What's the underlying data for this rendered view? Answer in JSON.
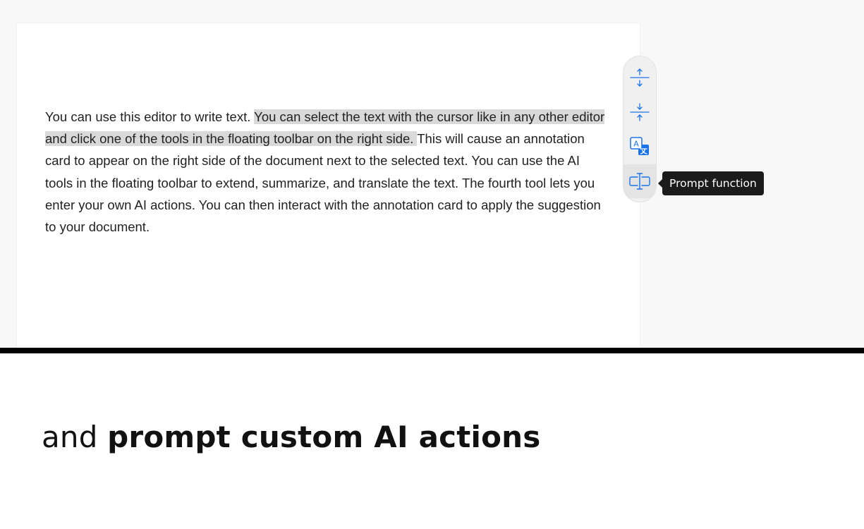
{
  "document": {
    "text_before": "You can use this editor to write text. ",
    "text_selected": "You can select the text with the cursor like in any other editor and click one of the tools in the floating toolbar on the right side. ",
    "text_after": "This will cause an annotation card to appear on the right side of the document next to the selected text. You can use the AI tools in the floating toolbar to extend, summarize, and translate the text. The fourth tool lets you enter your own AI actions. You can then interact with the annotation card to apply the suggestion to your document."
  },
  "toolbar": {
    "tools": [
      {
        "icon": "expand-icon",
        "active": false
      },
      {
        "icon": "compress-icon",
        "active": false
      },
      {
        "icon": "translate-icon",
        "active": false
      },
      {
        "icon": "prompt-icon",
        "active": true
      }
    ],
    "tooltip": "Prompt function",
    "accent_color": "#1a73e8"
  },
  "caption": {
    "regular": "and ",
    "bold": "prompt custom AI actions"
  }
}
